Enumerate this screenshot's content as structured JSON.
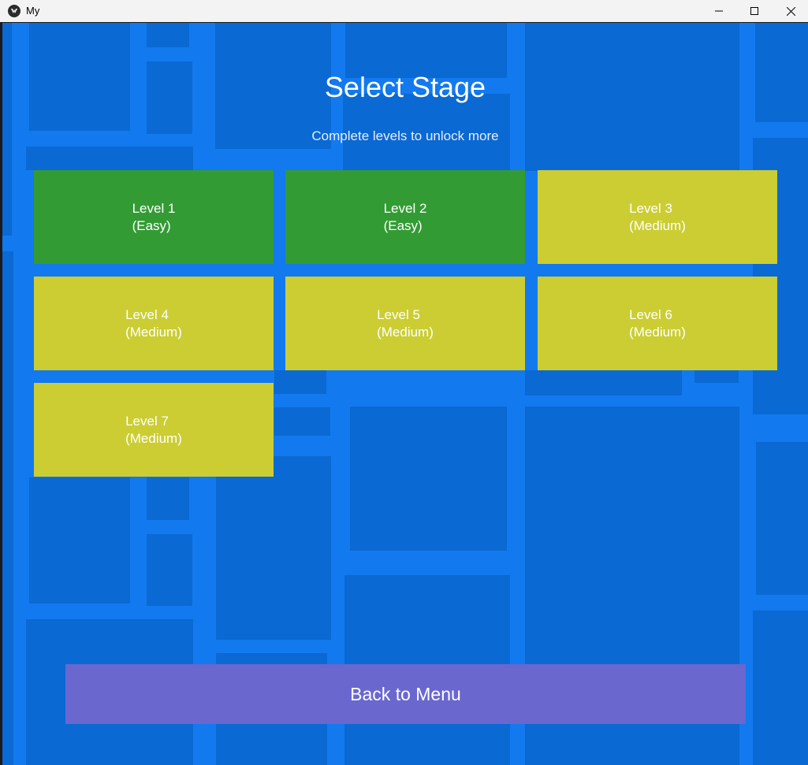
{
  "window": {
    "title": "My"
  },
  "screen": {
    "title": "Select Stage",
    "subtitle": "Complete levels to unlock more"
  },
  "levels": [
    {
      "name": "Level 1",
      "difficulty": "(Easy)"
    },
    {
      "name": "Level 2",
      "difficulty": "(Easy)"
    },
    {
      "name": "Level 3",
      "difficulty": "(Medium)"
    },
    {
      "name": "Level 4",
      "difficulty": "(Medium)"
    },
    {
      "name": "Level 5",
      "difficulty": "(Medium)"
    },
    {
      "name": "Level 6",
      "difficulty": "(Medium)"
    },
    {
      "name": "Level 7",
      "difficulty": "(Medium)"
    }
  ],
  "back_label": "Back to Menu",
  "colors": {
    "background": "#0a69d3",
    "background_road": "#1379ee",
    "easy": "#339b34",
    "medium": "#cbcd33",
    "back_button": "#6a67cf"
  }
}
